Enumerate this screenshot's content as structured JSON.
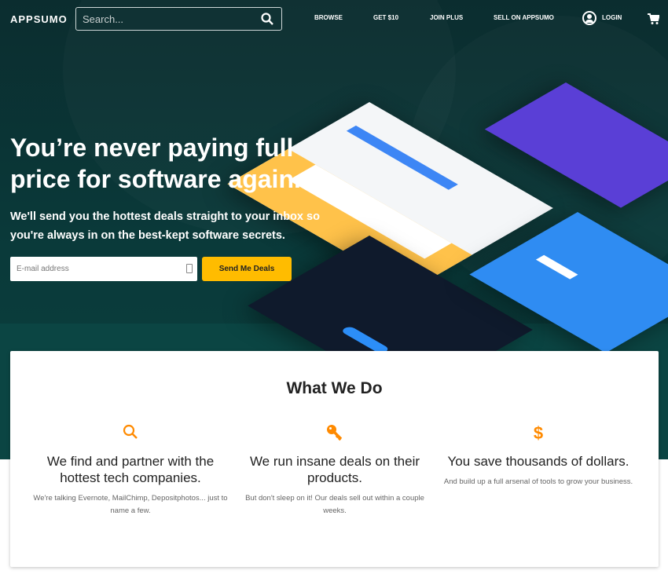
{
  "nav": {
    "logo": "APPSUMO",
    "search_placeholder": "Search...",
    "links": [
      "BROWSE",
      "GET $10",
      "JOIN PLUS",
      "SELL ON APPSUMO"
    ],
    "login": "LOGIN"
  },
  "hero": {
    "title": "You’re never paying full price for software again.",
    "subtitle": "We'll send you the hottest deals straight to your inbox so you're always in on the best-kept software secrets.",
    "email_placeholder": "E-mail address",
    "cta": "Send Me Deals"
  },
  "colors": {
    "accent": "#ffbc00",
    "icon": "#ff8a00",
    "hero_bg": "#0a3a3a"
  },
  "what": {
    "title": "What We Do",
    "items": [
      {
        "icon": "search-icon",
        "heading": "We find and partner with the hottest tech companies.",
        "text": "We're talking Evernote, MailChimp, Depositphotos... just to name a few."
      },
      {
        "icon": "key-icon",
        "heading": "We run insane deals on their products.",
        "text": "But don't sleep on it! Our deals sell out within a couple weeks."
      },
      {
        "icon": "dollar-icon",
        "heading": "You save thousands of dollars.",
        "text": "And build up a full arsenal of tools to grow your business."
      }
    ]
  }
}
